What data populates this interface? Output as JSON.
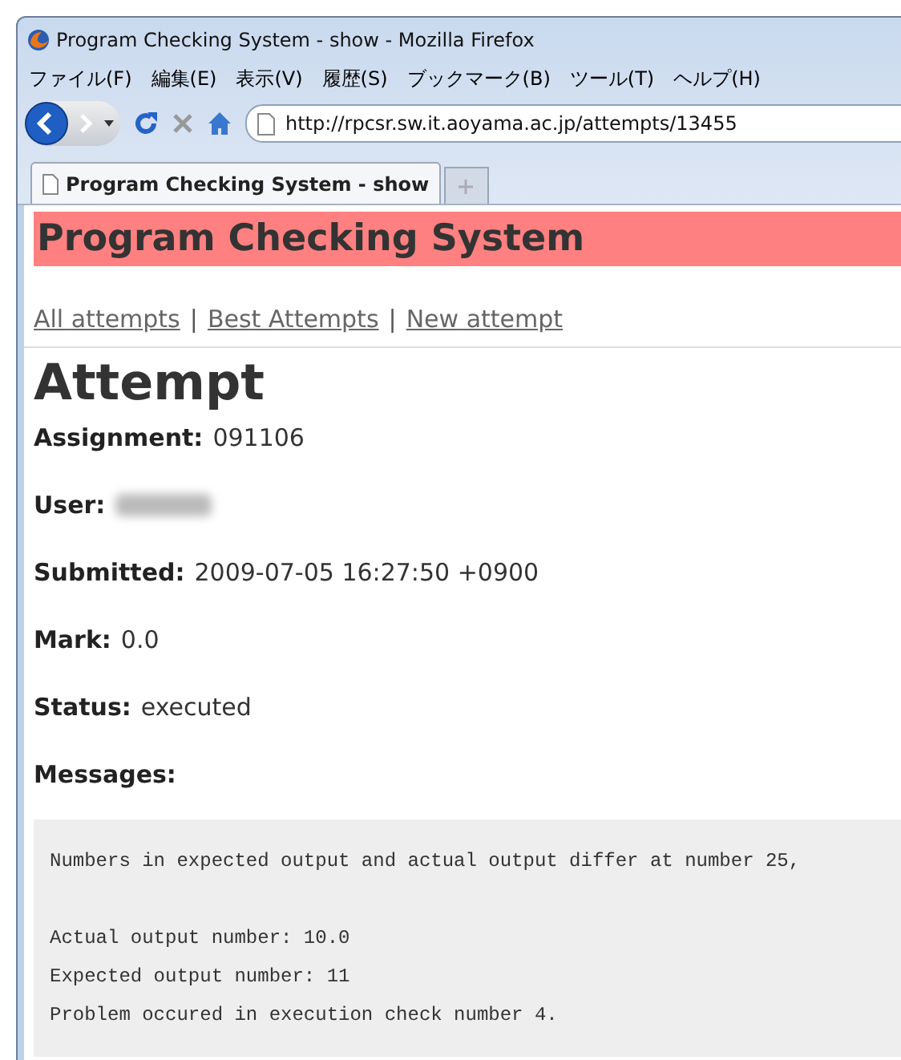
{
  "window": {
    "title": "Program Checking System - show - Mozilla Firefox"
  },
  "menu": [
    "ファイル(F)",
    "編集(E)",
    "表示(V)",
    "履歴(S)",
    "ブックマーク(B)",
    "ツール(T)",
    "ヘルプ(H)"
  ],
  "address": {
    "value": "http://rpcsr.sw.it.aoyama.ac.jp/attempts/13455"
  },
  "tabs": [
    {
      "label": "Program Checking System - show",
      "selected": true
    }
  ],
  "page": {
    "site_title": "Program Checking System",
    "nav_links": [
      "All attempts",
      "Best Attempts",
      "New attempt"
    ],
    "separator": "|",
    "heading": "Attempt",
    "fields": [
      {
        "label": "Assignment:",
        "value": "091106"
      },
      {
        "label": "User:",
        "kind": "blurred"
      },
      {
        "label": "Submitted:",
        "value": "2009-07-05 16:27:50 +0900"
      },
      {
        "label": "Mark:",
        "value": "0.0"
      },
      {
        "label": "Status:",
        "value": "executed"
      },
      {
        "label": "Messages:"
      }
    ],
    "message_paragraphs": [
      [
        "Numbers in expected output and actual output differ at number 25,"
      ],
      [
        "Actual output number: 10.0",
        "Expected output number: 11",
        "Problem occured in execution check number 4."
      ]
    ]
  }
}
